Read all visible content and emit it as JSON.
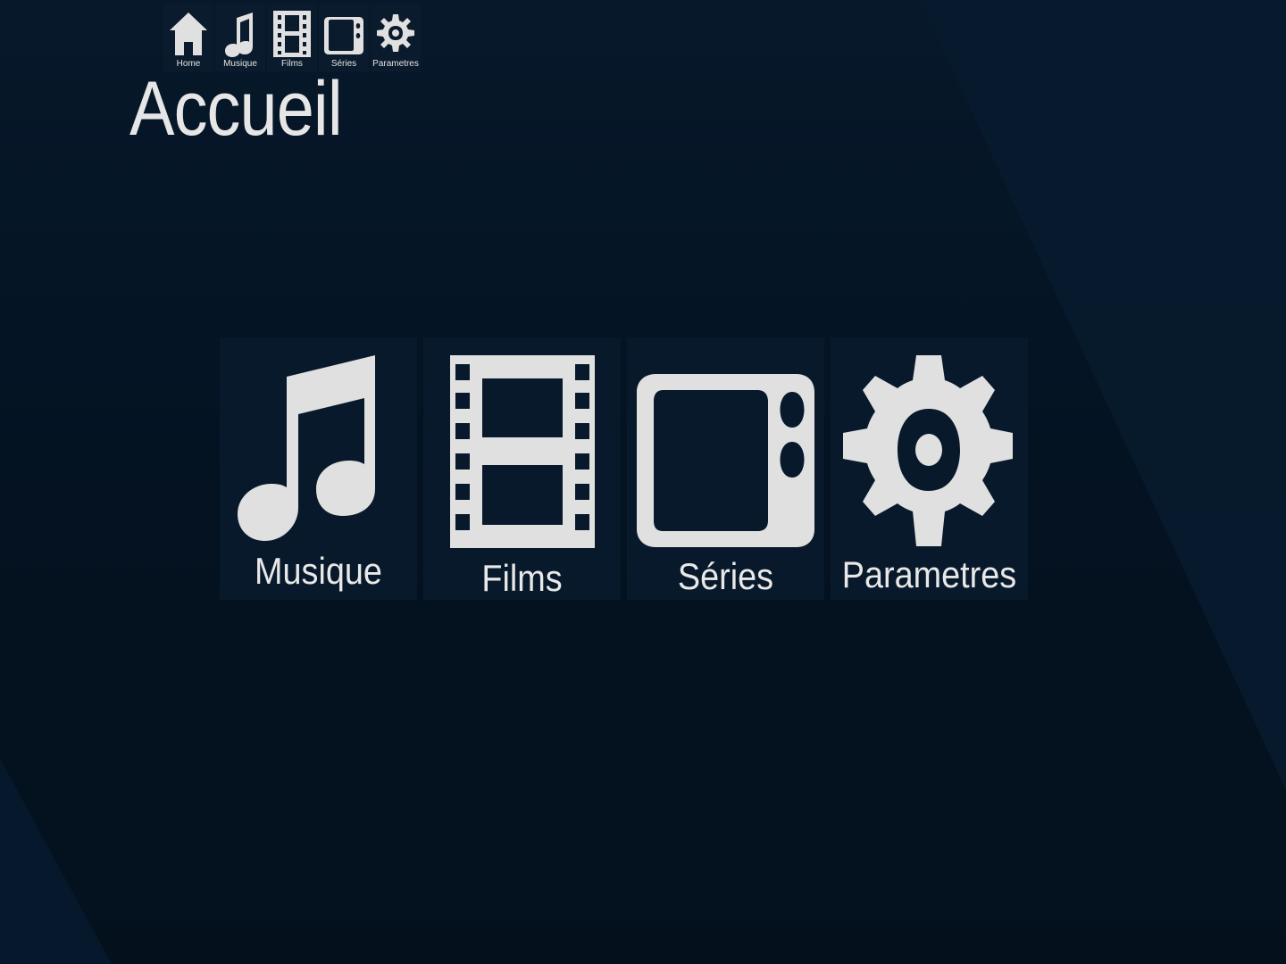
{
  "app": {
    "title": "Accueil"
  },
  "topnav": {
    "items": [
      {
        "label": "Home",
        "icon": "home-icon"
      },
      {
        "label": "Musique",
        "icon": "music-note-icon"
      },
      {
        "label": "Films",
        "icon": "film-strip-icon"
      },
      {
        "label": "Séries",
        "icon": "tv-icon"
      },
      {
        "label": "Parametres",
        "icon": "gear-icon"
      }
    ]
  },
  "tiles": [
    {
      "label": "Musique",
      "icon": "music-note-icon"
    },
    {
      "label": "Films",
      "icon": "film-strip-icon"
    },
    {
      "label": "Séries",
      "icon": "tv-icon"
    },
    {
      "label": "Parametres",
      "icon": "gear-icon"
    }
  ],
  "colors": {
    "background": "#061525",
    "panel": "#08192b",
    "icon": "#e0e0e0",
    "text": "#e6e6e6"
  }
}
